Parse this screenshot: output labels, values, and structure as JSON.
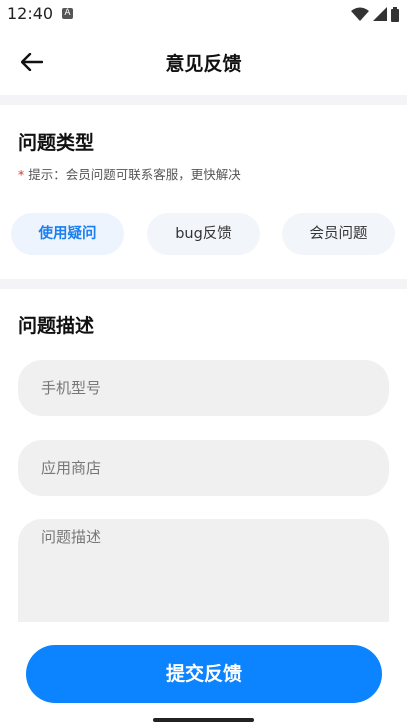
{
  "status_bar": {
    "time": "12:40",
    "notification_icon": "a-icon",
    "icons": [
      "wifi-icon",
      "signal-icon",
      "battery-icon"
    ]
  },
  "app_bar": {
    "back_icon": "arrow-left-icon",
    "title": "意见反馈"
  },
  "type_section": {
    "title": "问题类型",
    "hint_star": "*",
    "hint": "提示：会员问题可联系客服，更快解决",
    "chips": [
      {
        "label": "使用疑问",
        "selected": true
      },
      {
        "label": "bug反馈",
        "selected": false
      },
      {
        "label": "会员问题",
        "selected": false
      }
    ]
  },
  "desc_section": {
    "title": "问题描述",
    "phone_model_placeholder": "手机型号",
    "app_store_placeholder": "应用商店",
    "description_placeholder": "问题描述"
  },
  "submit_label": "提交反馈",
  "colors": {
    "accent": "#0d84ff",
    "selected_chip_text": "#1a7ff0",
    "field_bg": "#f0f0f0",
    "divider": "#f4f4f6",
    "hint_star": "#e03030"
  }
}
